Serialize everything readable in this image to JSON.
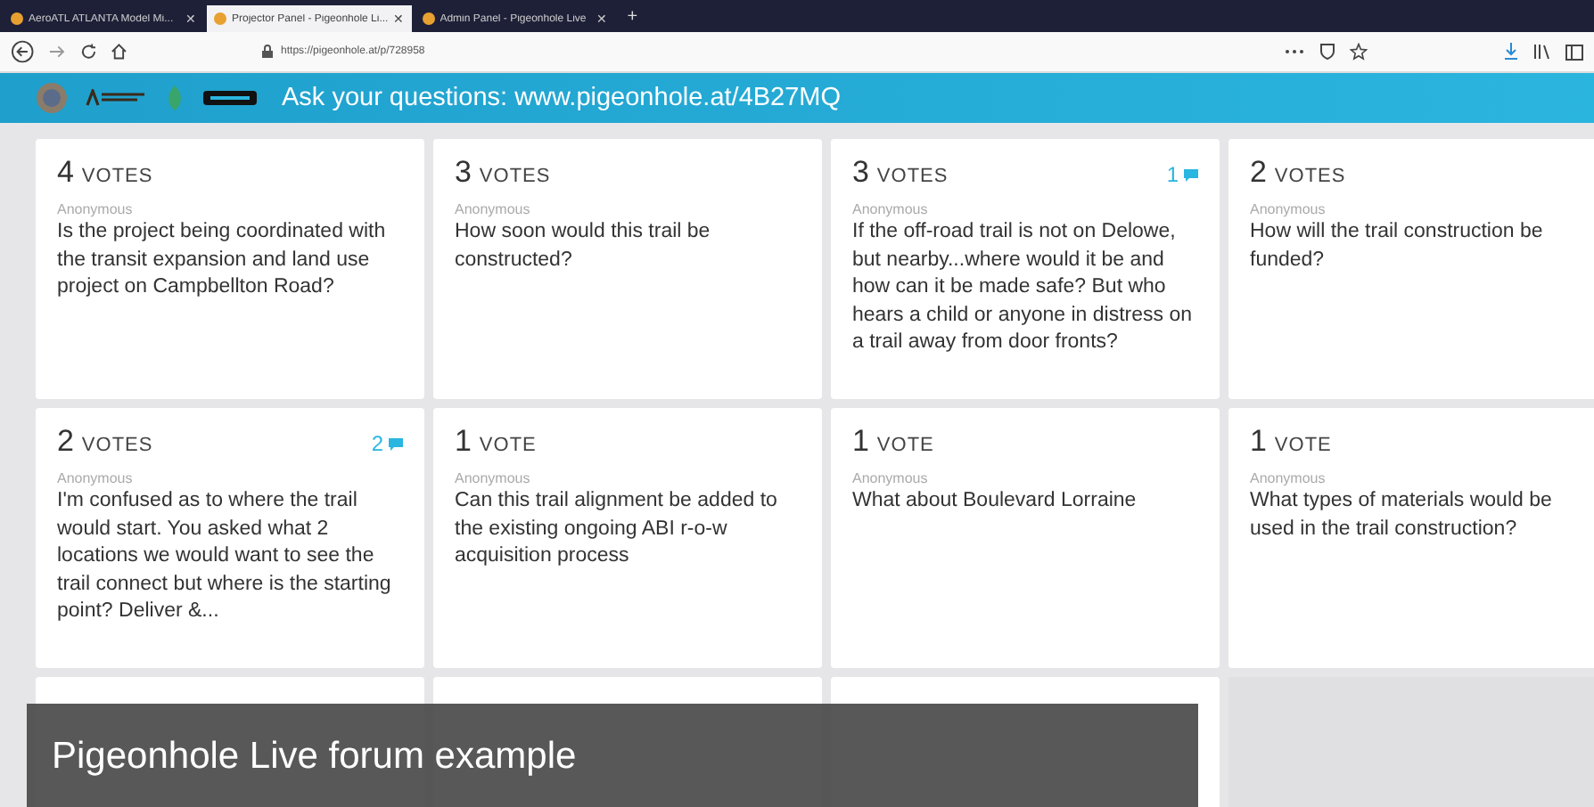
{
  "browser": {
    "tabs": [
      {
        "title": "AeroATL ATLANTA Model Mi...",
        "close": "✕",
        "selected": false
      },
      {
        "title": "Projector Panel - Pigeonhole Li...",
        "close": "✕",
        "selected": true
      },
      {
        "title": "Admin Panel - Pigeonhole Live",
        "close": "✕",
        "selected": false
      }
    ],
    "new_tab": "+",
    "url": "https://pigeonhole.at/p/728958"
  },
  "header": {
    "title": "Ask your questions: www.pigeonhole.at/4B27MQ"
  },
  "questions": [
    {
      "count": "4",
      "unit": "VOTES",
      "author": "Anonymous",
      "text": "Is the project being coordinated with the transit expansion and land use project on Campbellton Road?"
    },
    {
      "count": "3",
      "unit": "VOTES",
      "author": "Anonymous",
      "text": "How soon would this trail be constructed?"
    },
    {
      "count": "3",
      "unit": "VOTES",
      "author": "Anonymous",
      "text": "If the off-road trail is not on Delowe, but nearby...where would it be and how can it be made safe? But who hears a child or anyone in distress on a trail away from door fronts?",
      "comments": "1"
    },
    {
      "count": "2",
      "unit": "VOTES",
      "author": "Anonymous",
      "text": "How will the trail construction be funded?"
    },
    {
      "count": "2",
      "unit": "VOTES",
      "author": "Anonymous",
      "text": "I'm confused as to where the trail would start. You asked what 2 locations we would want to see the trail connect but where is the starting point? Deliver &...",
      "comments": "2"
    },
    {
      "count": "1",
      "unit": "VOTE",
      "author": "Anonymous",
      "text": "Can this trail alignment be added to the existing ongoing ABI r-o-w acquisition process"
    },
    {
      "count": "1",
      "unit": "VOTE",
      "author": "Anonymous",
      "text": "What about Boulevard Lorraine"
    },
    {
      "count": "1",
      "unit": "VOTE",
      "author": "Anonymous",
      "text": "What types of materials would be used in the trail construction?"
    }
  ],
  "caption": "Pigeonhole Live forum example"
}
